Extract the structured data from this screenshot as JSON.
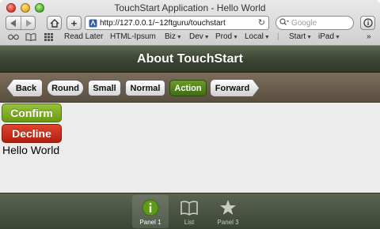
{
  "window": {
    "title": "TouchStart Application - Hello World"
  },
  "toolbar": {
    "url": "http://127.0.0.1/~12ftguru/touchstart",
    "search_placeholder": "Google"
  },
  "bookmarks": {
    "items": [
      {
        "label": "Read Later",
        "dropdown": false
      },
      {
        "label": "HTML-Ipsum",
        "dropdown": false
      },
      {
        "label": "Biz",
        "dropdown": true
      },
      {
        "label": "Dev",
        "dropdown": true
      },
      {
        "label": "Prod",
        "dropdown": true
      },
      {
        "label": "Local",
        "dropdown": true
      },
      {
        "label": "Start",
        "dropdown": true
      },
      {
        "label": "iPad",
        "dropdown": true
      }
    ],
    "overflow": "»"
  },
  "app": {
    "title": "About TouchStart",
    "buttons": [
      {
        "label": "Back",
        "style": "back"
      },
      {
        "label": "Round",
        "style": "round"
      },
      {
        "label": "Small",
        "style": "normal"
      },
      {
        "label": "Normal",
        "style": "normal"
      },
      {
        "label": "Action",
        "style": "action"
      },
      {
        "label": "Forward",
        "style": "forward"
      }
    ],
    "confirm_label": "Confirm",
    "decline_label": "Decline",
    "body_text": "Hello World",
    "tabs": [
      {
        "label": "Panel 1",
        "icon": "info-icon",
        "active": true
      },
      {
        "label": "List",
        "icon": "book-icon",
        "active": false
      },
      {
        "label": "Panel 3",
        "icon": "star-icon",
        "active": false
      }
    ]
  },
  "colors": {
    "header": "#3a4431",
    "button_bar": "#6b5f4e",
    "action": "#4f7f1a",
    "confirm": "#7aa81e",
    "decline": "#c8301c",
    "tabbar": "#4a5342"
  }
}
